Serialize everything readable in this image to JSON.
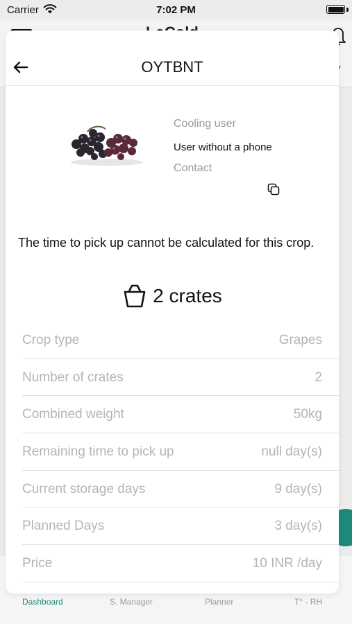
{
  "status_bar": {
    "carrier": "Carrier",
    "time": "7:02 PM"
  },
  "background": {
    "title": "LoCold",
    "tabs": [
      {
        "label": "Dashboard",
        "active": true
      },
      {
        "label": "S. Manager",
        "active": false
      },
      {
        "label": "Planner",
        "active": false
      },
      {
        "label": "T° - RH",
        "active": false
      }
    ]
  },
  "modal": {
    "title": "OYTBNT",
    "crop_image": "grapes-image",
    "user": {
      "role_label": "Cooling user",
      "name": "User without a phone",
      "contact_label": "Contact"
    },
    "message": "The time to pick up cannot be calculated for this crop.",
    "crates_summary": "2 crates",
    "details": [
      {
        "label": "Crop type",
        "value": "Grapes"
      },
      {
        "label": "Number of crates",
        "value": "2"
      },
      {
        "label": "Combined weight",
        "value": "50kg"
      },
      {
        "label": "Remaining time to pick up",
        "value": "null day(s)"
      },
      {
        "label": "Current storage days",
        "value": "9 day(s)"
      },
      {
        "label": "Planned Days",
        "value": "3 day(s)"
      },
      {
        "label": "Price",
        "value": "10 INR /day"
      }
    ]
  },
  "colors": {
    "accent": "#1e8a7a",
    "muted_text": "#b4b4b4",
    "label_text": "#9a9a9a"
  },
  "icons": [
    "wifi-icon",
    "battery-icon",
    "menu-icon",
    "bell-icon",
    "back-arrow-icon",
    "copy-icon",
    "crate-icon"
  ]
}
